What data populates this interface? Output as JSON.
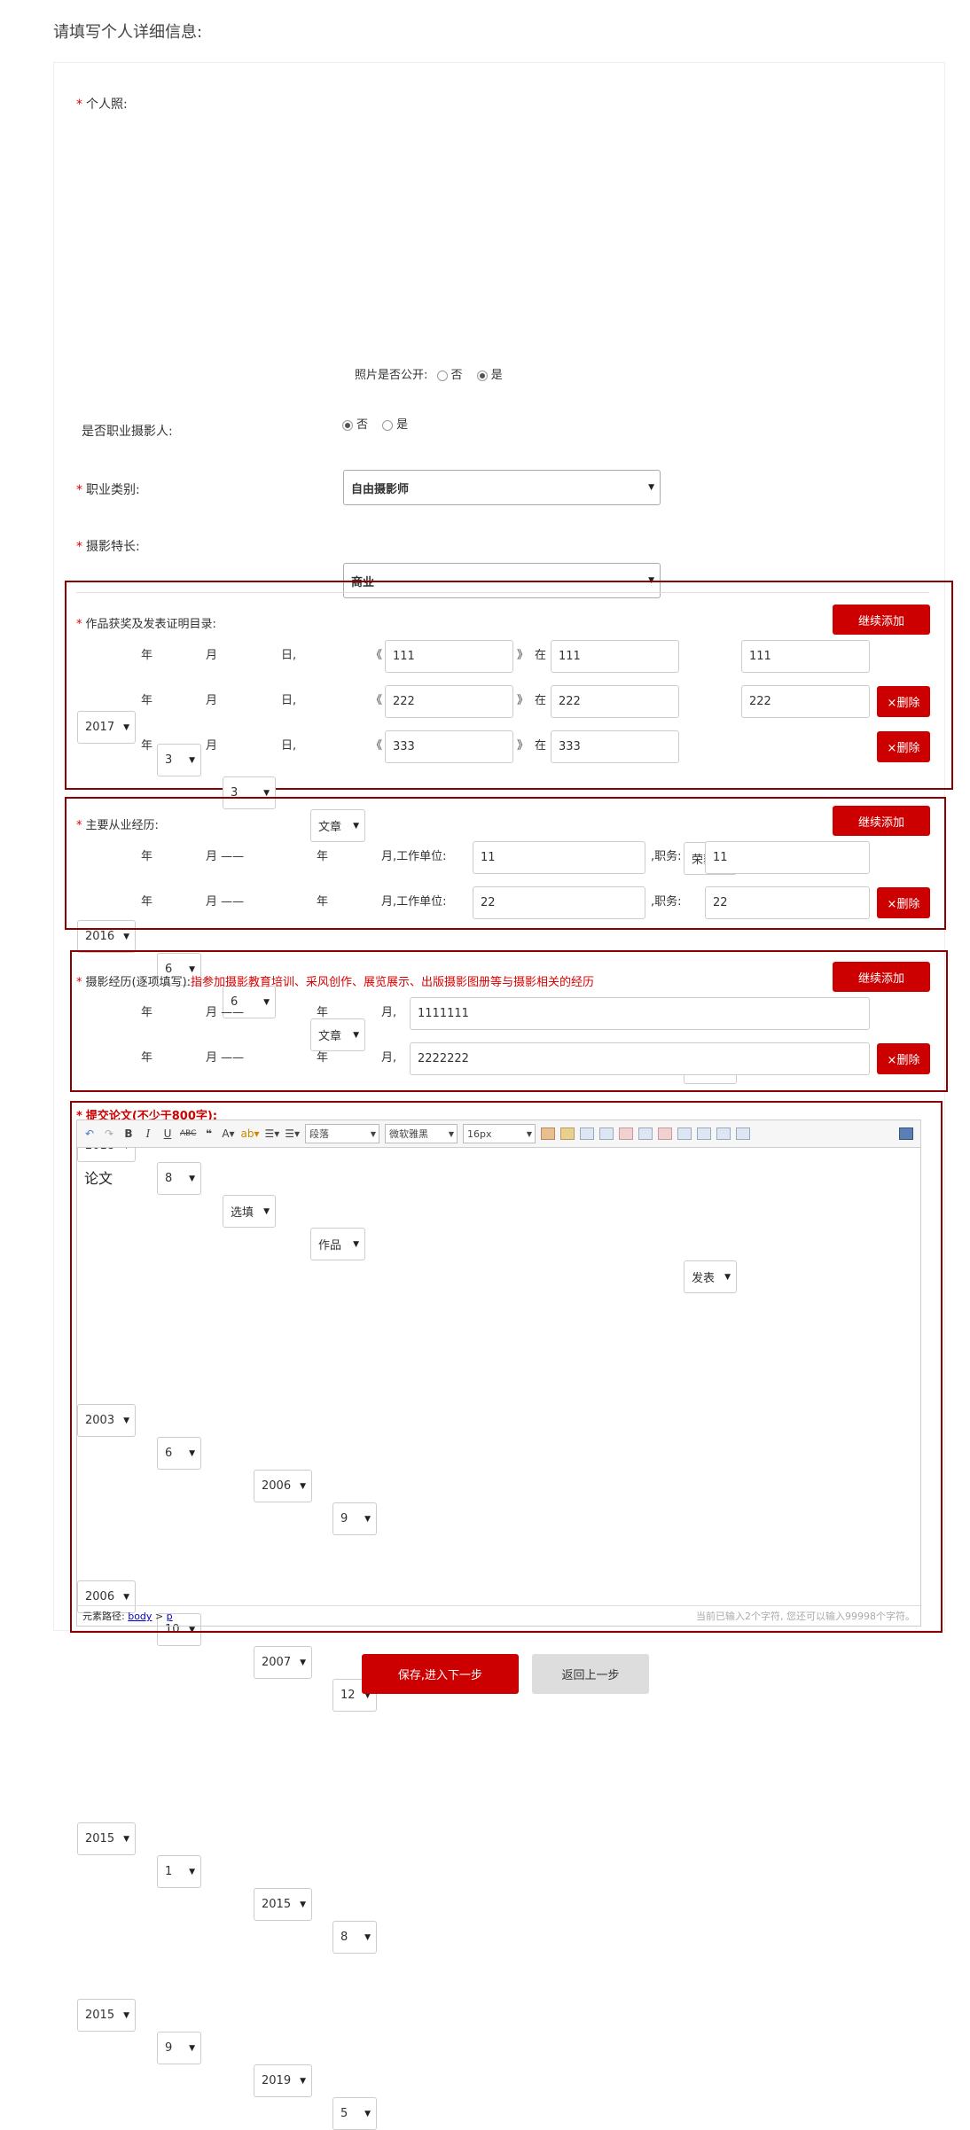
{
  "page_title": "请填写个人详细信息:",
  "photo": {
    "label": "个人照:",
    "public_question": "照片是否公开:",
    "options": [
      "否",
      "是"
    ],
    "selected": "是"
  },
  "professional": {
    "label": "是否职业摄影人:",
    "options": [
      "否",
      "是"
    ],
    "selected": "否"
  },
  "occupation": {
    "label": "职业类别:",
    "value": "自由摄影师"
  },
  "specialty": {
    "label": "摄影特长:",
    "value": "商业"
  },
  "awards": {
    "label": "作品获奖及发表证明目录:",
    "add_label": "继续添加",
    "delete_label": "×删除",
    "unit_year": "年",
    "unit_month": "月",
    "unit_day": "日,",
    "quote_open": "《",
    "quote_close": "》",
    "in_label": "在",
    "rows": [
      {
        "year": "2017",
        "month": "3",
        "day": "3",
        "type": "文章",
        "title": "111",
        "place": "111",
        "result": "荣获",
        "award": "111"
      },
      {
        "year": "2016",
        "month": "6",
        "day": "6",
        "type": "文章",
        "title": "222",
        "place": "222",
        "result": "荣获",
        "award": "222"
      },
      {
        "year": "2018",
        "month": "8",
        "day": "选填",
        "type": "作品",
        "title": "333",
        "place": "333",
        "result": "发表",
        "award": ""
      }
    ]
  },
  "career": {
    "label": "主要从业经历:",
    "add_label": "继续添加",
    "delete_label": "×删除",
    "unit_year": "年",
    "unit_month": "月",
    "dash": "——",
    "work_unit_label": "月,工作单位:",
    "position_label": ",职务:",
    "rows": [
      {
        "from_year": "2003",
        "from_month": "6",
        "to_year": "2006",
        "to_month": "9",
        "unit": "11",
        "position": "11"
      },
      {
        "from_year": "2006",
        "from_month": "10",
        "to_year": "2007",
        "to_month": "12",
        "unit": "22",
        "position": "22"
      }
    ]
  },
  "photo_experience": {
    "label": "摄影经历(逐项填写):",
    "note": "指参加摄影教育培训、采风创作、展览展示、出版摄影图册等与摄影相关的经历",
    "add_label": "继续添加",
    "delete_label": "×删除",
    "unit_year": "年",
    "unit_month": "月",
    "dash": "——",
    "month_comma": "月,",
    "rows": [
      {
        "from_year": "2015",
        "from_month": "1",
        "to_year": "2015",
        "to_month": "8",
        "desc": "1111111"
      },
      {
        "from_year": "2015",
        "from_month": "9",
        "to_year": "2019",
        "to_month": "5",
        "desc": "2222222"
      }
    ]
  },
  "essay": {
    "label": "提交论文(不少于800字):",
    "content": "论文",
    "toolbar": {
      "paragraph": "段落",
      "font": "微软雅黑",
      "size": "16px"
    },
    "status_prefix": "元素路径:",
    "path_body": "body",
    "path_sep": ">",
    "path_p": "p",
    "counter": "当前已输入2个字符, 您还可以输入99998个字符。"
  },
  "footer": {
    "save_label": "保存,进入下一步",
    "back_label": "返回上一步"
  }
}
